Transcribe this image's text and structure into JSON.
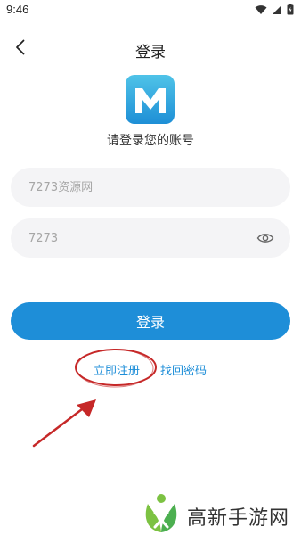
{
  "status_bar": {
    "time": "9:46"
  },
  "nav": {
    "title": "登录"
  },
  "logo": {
    "subtitle": "请登录您的账号"
  },
  "form": {
    "account": {
      "placeholder": "7273资源网"
    },
    "password": {
      "placeholder": "7273"
    },
    "login_label": "登录"
  },
  "links": {
    "register": "立即注册",
    "forgot": "找回密码"
  },
  "colors": {
    "primary": "#1e8ed8",
    "field_bg": "#f4f4f6",
    "annotation": "#c62828"
  },
  "watermark": {
    "text": "高新手游网"
  }
}
